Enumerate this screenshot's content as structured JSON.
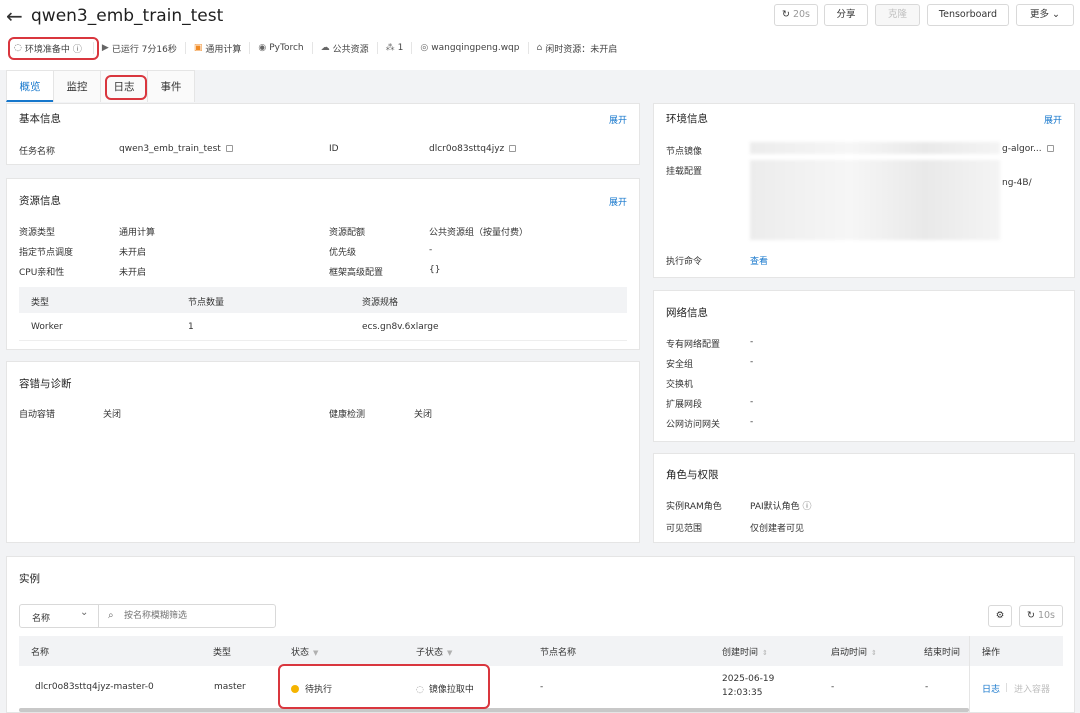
{
  "header": {
    "back_icon": "arrow-left-icon",
    "title": "qwen3_emb_train_test",
    "refresh_label": "20s",
    "share_label": "分享",
    "clone_label": "克隆",
    "tensorboard_label": "Tensorboard",
    "more_label": "更多"
  },
  "meta": {
    "status": "环境准备中",
    "running": "已运行 7分16秒",
    "compute": "通用计算",
    "framework": "PyTorch",
    "resource": "公共资源",
    "nodes": "1",
    "user": "wangqingpeng.wqp",
    "idle": "闲时资源：未开启"
  },
  "tabs": [
    "概览",
    "监控",
    "日志",
    "事件"
  ],
  "basic": {
    "title": "基本信息",
    "expand": "展开",
    "name_label": "任务名称",
    "name_value": "qwen3_emb_train_test",
    "id_label": "ID",
    "id_value": "dlcr0o83sttq4jyz"
  },
  "resource": {
    "title": "资源信息",
    "expand": "展开",
    "type_label": "资源类型",
    "type_value": "通用计算",
    "quota_label": "资源配额",
    "quota_value": "公共资源组（按量付费）",
    "sched_label": "指定节点调度",
    "sched_value": "未开启",
    "priority_label": "优先级",
    "priority_value": "-",
    "cpu_label": "CPU亲和性",
    "cpu_value": "未开启",
    "framework_label": "框架高级配置",
    "framework_value": "{}",
    "table_headers": [
      "类型",
      "节点数量",
      "资源规格"
    ],
    "table_row": [
      "Worker",
      "1",
      "ecs.gn8v.6xlarge"
    ]
  },
  "fault": {
    "title": "容错与诊断",
    "auto_label": "自动容错",
    "auto_value": "关闭",
    "health_label": "健康检测",
    "health_value": "关闭"
  },
  "env": {
    "title": "环境信息",
    "expand": "展开",
    "image_label": "节点镜像",
    "image_suffix": "g-algor...",
    "mount_label": "挂载配置",
    "mount_suffix": "ng-4B/",
    "cmd_label": "执行命令",
    "cmd_link": "查看"
  },
  "network": {
    "title": "网络信息",
    "rows": [
      {
        "label": "专有网络配置",
        "value": "-"
      },
      {
        "label": "安全组",
        "value": "-"
      },
      {
        "label": "交换机",
        "value": ""
      },
      {
        "label": "扩展网段",
        "value": "-"
      },
      {
        "label": "公网访问网关",
        "value": "-"
      }
    ]
  },
  "roles": {
    "title": "角色与权限",
    "ram_label": "实例RAM角色",
    "ram_value": "PAI默认角色",
    "scope_label": "可见范围",
    "scope_value": "仅创建者可见"
  },
  "instances": {
    "title": "实例",
    "filter_select": "名称",
    "search_placeholder": "按名称模糊筛选",
    "refresh_label": "10s",
    "headers": [
      "名称",
      "类型",
      "状态",
      "子状态",
      "节点名称",
      "创建时间",
      "启动时间",
      "结束时间",
      "操作"
    ],
    "row": {
      "name": "dlcr0o83sttq4jyz-master-0",
      "type": "master",
      "status": "待执行",
      "substatus": "镜像拉取中",
      "node": "-",
      "created_date": "2025-06-19",
      "created_time": "12:03:35",
      "started": "-",
      "ended": "-",
      "action_log": "日志",
      "action_enter": "进入容器"
    }
  },
  "colors": {
    "accent": "#1677cc",
    "highlight": "#d9363e",
    "pending": "#f5b400"
  }
}
